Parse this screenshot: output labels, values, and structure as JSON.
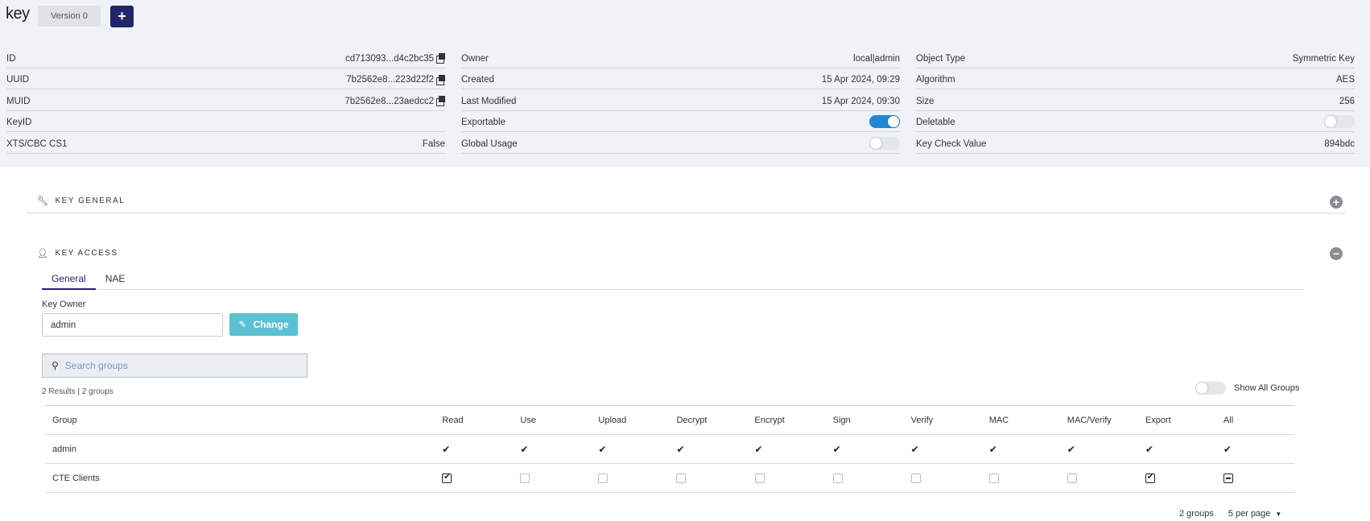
{
  "header": {
    "title": "key",
    "version_label": "Version 0",
    "add_label": "+"
  },
  "properties": {
    "col1": [
      {
        "label": "ID",
        "value": "cd713093...d4c2bc35",
        "copy": true
      },
      {
        "label": "UUID",
        "value": "7b2562e8...223d22f2",
        "copy": true
      },
      {
        "label": "MUID",
        "value": "7b2562e8...23aedcc2",
        "copy": true
      },
      {
        "label": "KeyID",
        "value": ""
      },
      {
        "label": "XTS/CBC CS1",
        "value": "False"
      }
    ],
    "col2": [
      {
        "label": "Owner",
        "value": "local|admin"
      },
      {
        "label": "Created",
        "value": "15 Apr 2024, 09:29"
      },
      {
        "label": "Last Modified",
        "value": "15 Apr 2024, 09:30"
      },
      {
        "label": "Exportable",
        "toggle": true
      },
      {
        "label": "Global Usage",
        "toggle": false
      }
    ],
    "col3": [
      {
        "label": "Object Type",
        "value": "Symmetric Key"
      },
      {
        "label": "Algorithm",
        "value": "AES"
      },
      {
        "label": "Size",
        "value": "256"
      },
      {
        "label": "Deletable",
        "toggle": false
      },
      {
        "label": "Key Check Value",
        "value": "894bdc"
      }
    ]
  },
  "sections": {
    "key_general": "KEY GENERAL",
    "key_access": "KEY ACCESS"
  },
  "tabs": [
    {
      "label": "General",
      "active": true
    },
    {
      "label": "NAE",
      "active": false
    }
  ],
  "key_owner": {
    "label": "Key Owner",
    "value": "admin",
    "change_label": "Change"
  },
  "search": {
    "placeholder": "Search groups"
  },
  "results_text": "2 Results | 2 groups",
  "show_all_label": "Show All Groups",
  "table": {
    "columns": [
      "Group",
      "Read",
      "Use",
      "Upload",
      "Decrypt",
      "Encrypt",
      "Sign",
      "Verify",
      "MAC",
      "MAC/Verify",
      "Export",
      "All"
    ],
    "rows": [
      {
        "group": "admin",
        "cells": [
          "check",
          "check",
          "check",
          "check",
          "check",
          "check",
          "check",
          "check",
          "check",
          "check",
          "check"
        ]
      },
      {
        "group": "CTE Clients",
        "cells": [
          "checked",
          "empty",
          "empty",
          "empty",
          "empty",
          "empty",
          "empty",
          "empty",
          "empty",
          "checked",
          "partial"
        ]
      }
    ]
  },
  "pagination": {
    "count": "2 groups",
    "per_page": "5 per page"
  }
}
